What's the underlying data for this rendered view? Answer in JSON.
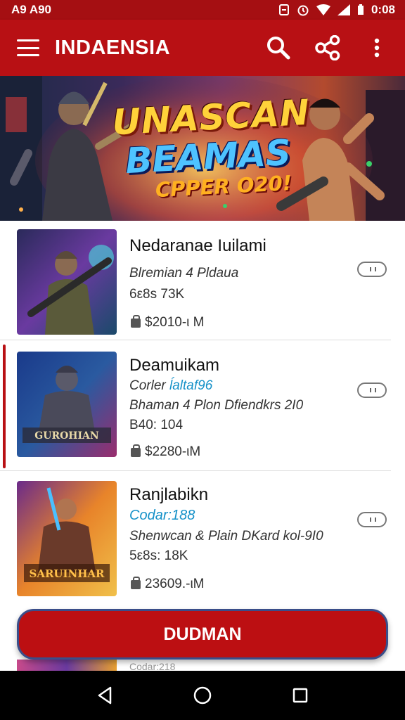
{
  "status_bar": {
    "left_text": "A9 A90",
    "time": "0:08"
  },
  "app_bar": {
    "title": "INDAENSIA"
  },
  "banner": {
    "line1": "UNASCAN",
    "line2": "BEAMAS",
    "line3": "CPPER O20!"
  },
  "items": [
    {
      "title": "Nedaranae Iuilami",
      "line1": "Blremian 4 Pldaua",
      "line2": "6ε8s 73K",
      "price": "$2010-ι M",
      "selected": false
    },
    {
      "title": "Deamuikam",
      "subtitle_prefix": "Corler ",
      "subtitle_accent": "ĺaltaf96",
      "line1": "Bhaman 4 Plon Dfiendkrs 2I0",
      "line2": "B40: 104",
      "price": "$2280-ιM",
      "selected": true
    },
    {
      "title": "Ranjlabikn",
      "subtitle_prefix": "",
      "subtitle_accent": "Codar:188",
      "line1": "Shenwcan & Plain DKard kol-9I0",
      "line2": "5ε8s: 18K",
      "price": "23609.-ιM",
      "selected": false
    }
  ],
  "thumb_labels": [
    "GUROHIAN",
    "SARUINHAR"
  ],
  "cta": {
    "label": "DUDMAN"
  },
  "peek_text": "Codar:218",
  "colors": {
    "primary": "#b81014",
    "status_bar": "#a50f12",
    "accent_text": "#1591c8",
    "nav": "#000000"
  },
  "icons": [
    "hamburger-icon",
    "search-icon",
    "share-icon",
    "more-vert-icon",
    "back-icon",
    "home-icon",
    "recents-icon",
    "bag-icon"
  ]
}
